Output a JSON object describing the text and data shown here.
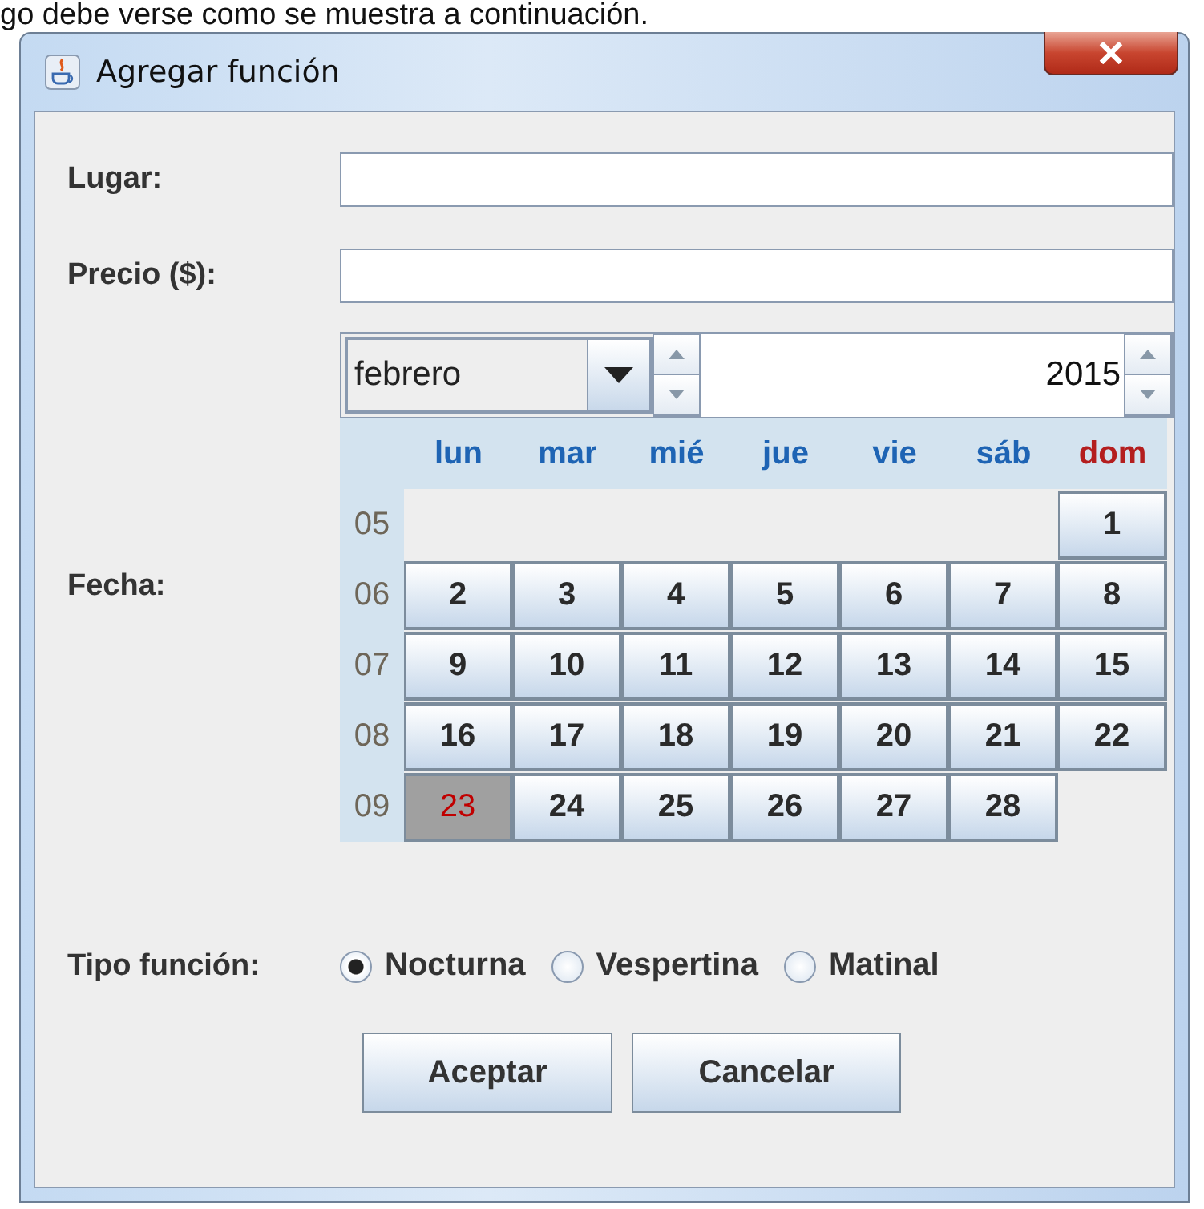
{
  "caption": "go debe verse como se muestra a continuación.",
  "window": {
    "title": "Agregar función"
  },
  "fields": [
    {
      "label": "Lugar:"
    },
    {
      "label": "Precio ($):"
    }
  ],
  "date": {
    "label": "Fecha:",
    "month": "febrero",
    "year": "2015",
    "weekdays": [
      {
        "label": "lun",
        "color": "#1e64b4"
      },
      {
        "label": "mar",
        "color": "#1e64b4"
      },
      {
        "label": "mié",
        "color": "#1e64b4"
      },
      {
        "label": "jue",
        "color": "#1e64b4"
      },
      {
        "label": "vie",
        "color": "#1e64b4"
      },
      {
        "label": "sáb",
        "color": "#1e64b4"
      },
      {
        "label": "dom",
        "color": "#b41e1e"
      }
    ],
    "weeks": [
      {
        "week": "05",
        "days": [
          {
            "day": "1",
            "selected": false
          }
        ]
      },
      {
        "week": "06",
        "days": [
          {
            "day": "2",
            "selected": false
          },
          {
            "day": "3",
            "selected": false
          },
          {
            "day": "4",
            "selected": false
          },
          {
            "day": "5",
            "selected": false
          },
          {
            "day": "6",
            "selected": false
          },
          {
            "day": "7",
            "selected": false
          },
          {
            "day": "8",
            "selected": false
          }
        ]
      },
      {
        "week": "07",
        "days": [
          {
            "day": "9",
            "selected": false
          },
          {
            "day": "10",
            "selected": false
          },
          {
            "day": "11",
            "selected": false
          },
          {
            "day": "12",
            "selected": false
          },
          {
            "day": "13",
            "selected": false
          },
          {
            "day": "14",
            "selected": false
          },
          {
            "day": "15",
            "selected": false
          }
        ]
      },
      {
        "week": "08",
        "days": [
          {
            "day": "16",
            "selected": false
          },
          {
            "day": "17",
            "selected": false
          },
          {
            "day": "18",
            "selected": false
          },
          {
            "day": "19",
            "selected": false
          },
          {
            "day": "20",
            "selected": false
          },
          {
            "day": "21",
            "selected": false
          },
          {
            "day": "22",
            "selected": false
          }
        ]
      },
      {
        "week": "09",
        "days": [
          {
            "day": "23",
            "selected": true
          },
          {
            "day": "24",
            "selected": false
          },
          {
            "day": "25",
            "selected": false
          },
          {
            "day": "26",
            "selected": false
          },
          {
            "day": "27",
            "selected": false
          },
          {
            "day": "28",
            "selected": false
          }
        ]
      }
    ]
  },
  "type": {
    "label": "Tipo función:",
    "options": [
      {
        "label": "Nocturna",
        "selected": true
      },
      {
        "label": "Vespertina",
        "selected": false
      },
      {
        "label": "Matinal",
        "selected": false
      }
    ]
  },
  "buttons": [
    "Aceptar",
    "Cancelar"
  ]
}
